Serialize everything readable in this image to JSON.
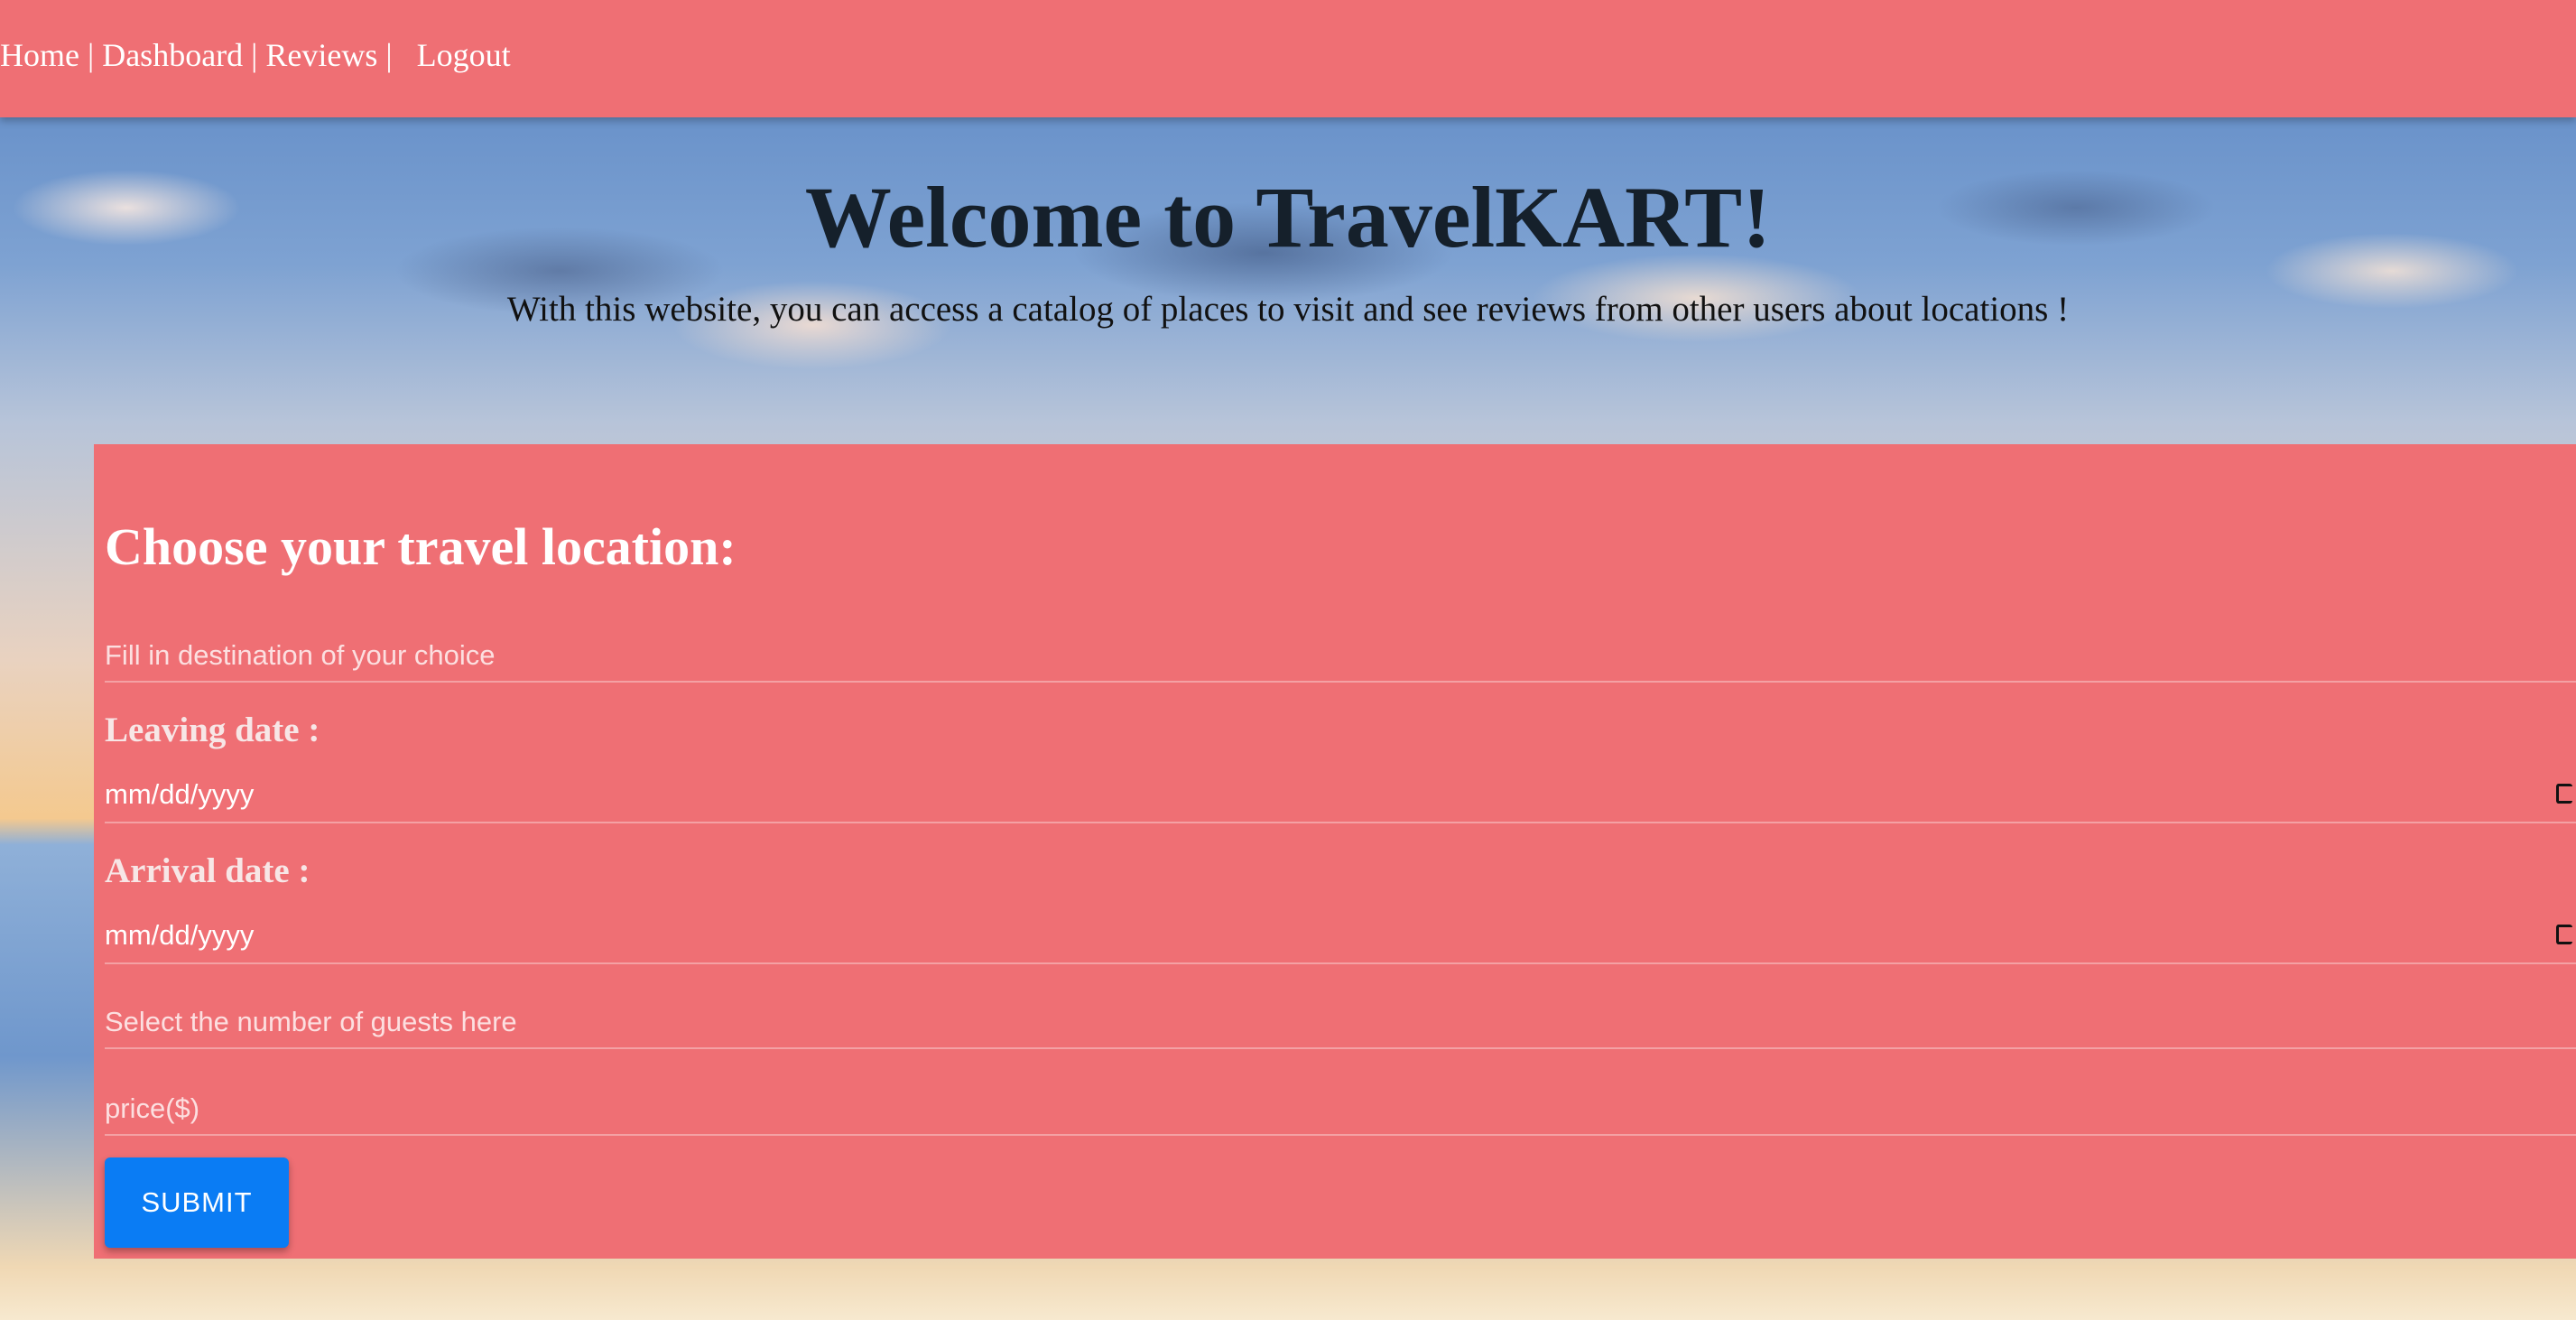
{
  "nav": {
    "home": "Home",
    "dashboard": "Dashboard",
    "reviews": "Reviews",
    "logout": "Logout",
    "separator": "|"
  },
  "hero": {
    "title": "Welcome to TravelKART!",
    "subtitle": "With this website, you can access a catalog of places to visit and see reviews from other users about locations !"
  },
  "form": {
    "heading": "Choose your travel location:",
    "destination_placeholder": "Fill in destination of your choice",
    "leaving_label": "Leaving date :",
    "leaving_value": "mm/dd/yyyy",
    "arrival_label": "Arrival date :",
    "arrival_value": "mm/dd/yyyy",
    "guests_placeholder": "Select the number of guests here",
    "price_placeholder": "price($)",
    "submit_label": "SUBMIT"
  },
  "colors": {
    "panel": "#ef6f74",
    "button": "#0a7cf4",
    "title": "#15202b"
  }
}
